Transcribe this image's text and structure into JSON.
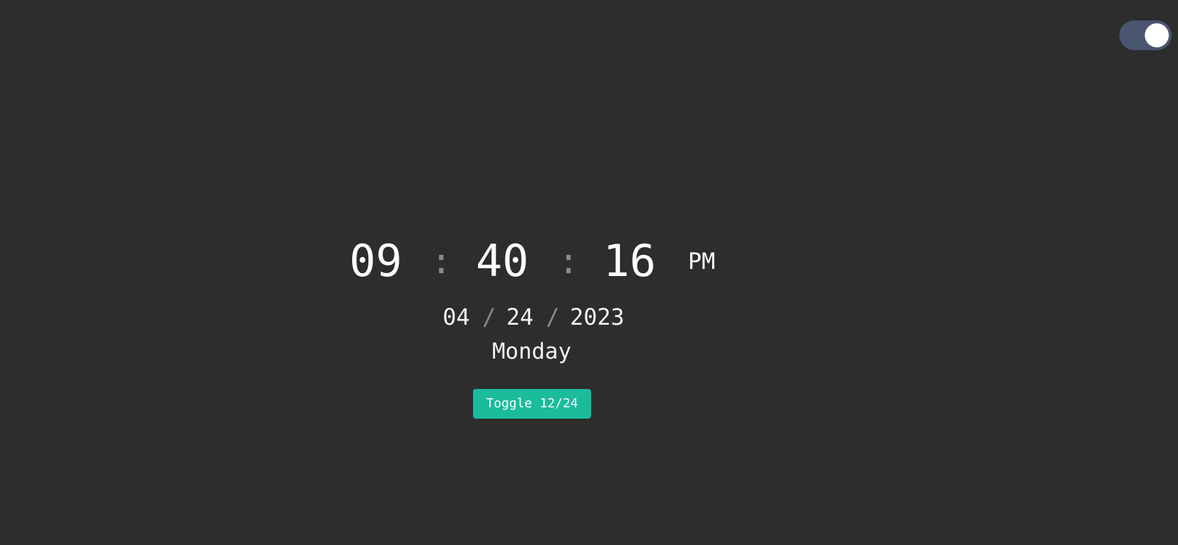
{
  "clock": {
    "hours": "09",
    "minutes": "40",
    "seconds": "16",
    "separator": ":",
    "ampm": "PM"
  },
  "date": {
    "month": "04",
    "day": "24",
    "year": "2023",
    "separator": "/",
    "weekday": "Monday"
  },
  "controls": {
    "format_toggle_label": "Toggle 12/24",
    "theme_toggle_state": "on"
  },
  "colors": {
    "background": "#2d2d2d",
    "accent": "#1abc9c",
    "toggle_track": "#4a5670",
    "separator": "#8a8a8a",
    "text": "#ffffff"
  }
}
